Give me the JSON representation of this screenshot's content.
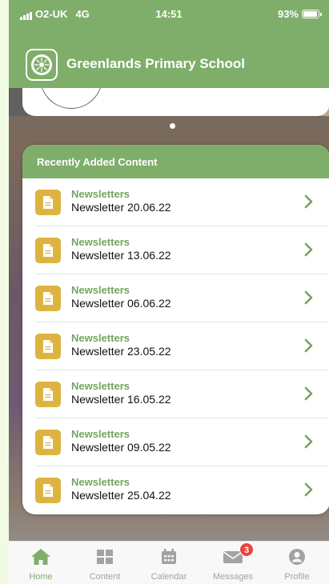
{
  "status_bar": {
    "carrier": "O2-UK",
    "network": "4G",
    "time": "14:51",
    "battery": "93%",
    "battery_level": 0.93
  },
  "app_bar": {
    "title": "Greenlands Primary School",
    "logo_icon": "school-logo-icon"
  },
  "recent": {
    "header": "Recently Added Content",
    "items": [
      {
        "category": "Newsletters",
        "title": "Newsletter 20.06.22"
      },
      {
        "category": "Newsletters",
        "title": "Newsletter 13.06.22"
      },
      {
        "category": "Newsletters",
        "title": "Newsletter 06.06.22"
      },
      {
        "category": "Newsletters",
        "title": "Newsletter 23.05.22"
      },
      {
        "category": "Newsletters",
        "title": "Newsletter 16.05.22"
      },
      {
        "category": "Newsletters",
        "title": "Newsletter 09.05.22"
      },
      {
        "category": "Newsletters",
        "title": "Newsletter 25.04.22"
      }
    ]
  },
  "tabs": [
    {
      "label": "Home",
      "icon": "home-icon",
      "active": true
    },
    {
      "label": "Content",
      "icon": "grid-icon",
      "active": false
    },
    {
      "label": "Calendar",
      "icon": "calendar-icon",
      "active": false
    },
    {
      "label": "Messages",
      "icon": "envelope-icon",
      "active": false,
      "badge": "3"
    },
    {
      "label": "Profile",
      "icon": "profile-icon",
      "active": false
    }
  ],
  "colors": {
    "brand_green": "#7fae6a",
    "item_title_green": "#72a55c",
    "doc_icon_gold": "#dcb440",
    "badge_red": "#e8453c"
  }
}
